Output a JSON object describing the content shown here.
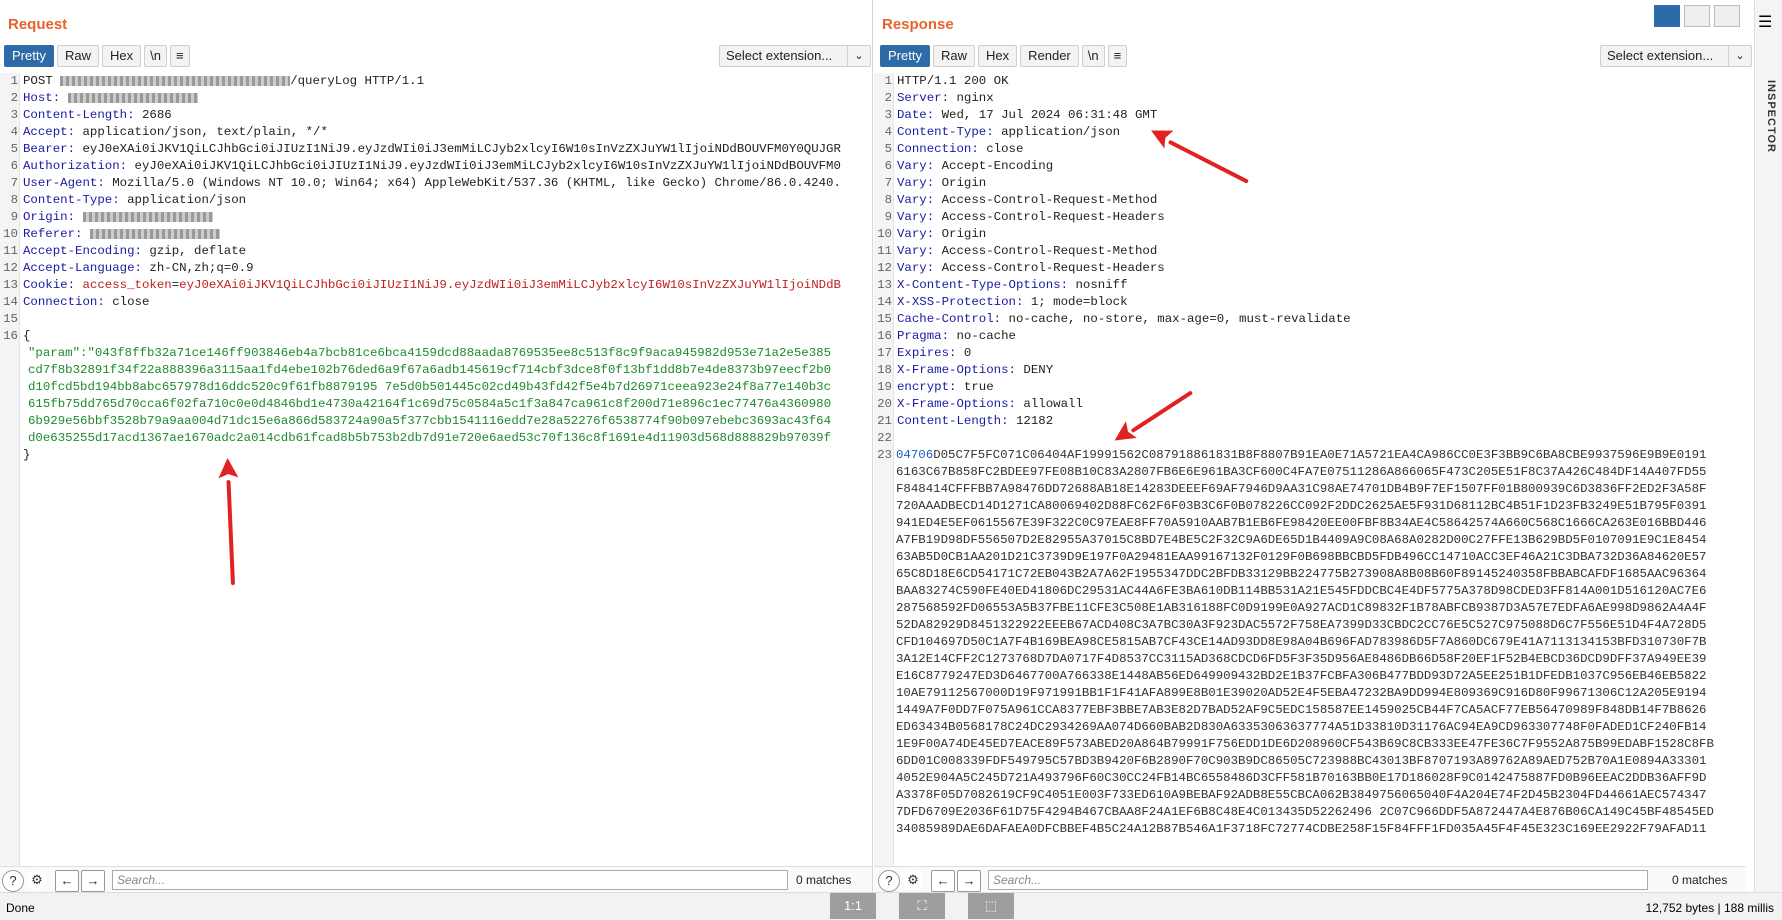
{
  "request": {
    "title": "Request",
    "tabs": [
      "Pretty",
      "Raw",
      "Hex",
      "\\n"
    ],
    "extension": "Select extension...",
    "lines": [
      {
        "n": "1",
        "parts": [
          [
            "plain",
            "POST "
          ],
          [
            "mask",
            ""
          ],
          [
            "plain",
            "/queryLog HTTP/1.1"
          ]
        ]
      },
      {
        "n": "2",
        "parts": [
          [
            "key",
            "Host: "
          ],
          [
            "mask",
            ""
          ]
        ]
      },
      {
        "n": "3",
        "parts": [
          [
            "key",
            "Content-Length: "
          ],
          [
            "plain",
            "2686"
          ]
        ]
      },
      {
        "n": "4",
        "parts": [
          [
            "key",
            "Accept: "
          ],
          [
            "plain",
            "application/json, text/plain, */*"
          ]
        ]
      },
      {
        "n": "5",
        "parts": [
          [
            "key",
            "Bearer: "
          ],
          [
            "plain",
            "eyJ0eXAi0iJKV1QiLCJhbGci0iJIUzI1NiJ9.eyJzdWIi0iJ3emMiLCJyb2xlcyI6W10sInVzZXJuYW1lIjoiNDdBOUVFM0Y0QUJGR"
          ]
        ]
      },
      {
        "n": "6",
        "parts": [
          [
            "key",
            "Authorization: "
          ],
          [
            "plain",
            "eyJ0eXAi0iJKV1QiLCJhbGci0iJIUzI1NiJ9.eyJzdWIi0iJ3emMiLCJyb2xlcyI6W10sInVzZXJuYW1lIjoiNDdBOUVFM0"
          ]
        ]
      },
      {
        "n": "7",
        "parts": [
          [
            "key",
            "User-Agent: "
          ],
          [
            "plain",
            "Mozilla/5.0 (Windows NT 10.0; Win64; x64) AppleWebKit/537.36 (KHTML, like Gecko) Chrome/86.0.4240."
          ]
        ]
      },
      {
        "n": "8",
        "parts": [
          [
            "key",
            "Content-Type: "
          ],
          [
            "plain",
            "application/json"
          ]
        ]
      },
      {
        "n": "9",
        "parts": [
          [
            "key",
            "Origin: "
          ],
          [
            "mask",
            ""
          ]
        ]
      },
      {
        "n": "10",
        "parts": [
          [
            "key",
            "Referer: "
          ],
          [
            "mask",
            ""
          ]
        ]
      },
      {
        "n": "11",
        "parts": [
          [
            "key",
            "Accept-Encoding: "
          ],
          [
            "plain",
            "gzip, deflate"
          ]
        ]
      },
      {
        "n": "12",
        "parts": [
          [
            "key",
            "Accept-Language: "
          ],
          [
            "plain",
            "zh-CN,zh;q=0.9"
          ]
        ]
      },
      {
        "n": "13",
        "parts": [
          [
            "key",
            "Cookie: "
          ],
          [
            "ckey",
            "access_token"
          ],
          [
            "plain",
            "="
          ],
          [
            "ckey",
            "eyJ0eXAi0iJKV1QiLCJhbGci0iJIUzI1NiJ9.eyJzdWIi0iJ3emMiLCJyb2xlcyI6W10sInVzZXJuYW1lIjoiNDdB"
          ]
        ]
      },
      {
        "n": "14",
        "parts": [
          [
            "key",
            "Connection: "
          ],
          [
            "plain",
            "close"
          ]
        ]
      },
      {
        "n": "15",
        "parts": []
      },
      {
        "n": "16",
        "parts": [
          [
            "plain",
            "{"
          ]
        ]
      }
    ],
    "json_lines": [
      "\"param\":\"043f8ffb32a71ce146ff903846eb4a7bcb81ce6bca4159dcd88aada8769535ee8c513f8c9f9aca945982d953e71a2e5e385",
      "cd7f8b32891f34f22a888396a3115aa1fd4ebe102b76ded6a9f67a6adb145619cf714cbf3dce8f0f13bf1dd8b7e4de8373b97eecf2b0",
      "d10fcd5bd194bb8abc657978d16ddc520c9f61fb8879195 7e5d0b501445c02cd49b43fd42f5e4b7d26971ceea923e24f8a77e140b3c",
      "615fb75dd765d70cca6f02fa710c0e0d4846bd1e4730a42164f1c69d75c0584a5c1f3a847ca961c8f200d71e896c1ec77476a4360980",
      "6b929e56bbf3528b79a9aa004d71dc15e6a866d583724a90a5f377cbb1541116edd7e28a52276f6538774f90b097ebebc3693ac43f64",
      "d0e635255d17acd1367ae1670adc2a014cdb61fcad8b5b753b2db7d91e720e6aed53c70f136c8f1691e4d11903d568d888829b97039f"
    ],
    "close_brace": "}",
    "search_placeholder": "Search...",
    "matches": "0 matches"
  },
  "response": {
    "title": "Response",
    "tabs": [
      "Pretty",
      "Raw",
      "Hex",
      "Render",
      "\\n"
    ],
    "extension": "Select extension...",
    "lines": [
      {
        "n": "1",
        "parts": [
          [
            "plain",
            "HTTP/1.1 200 OK"
          ]
        ]
      },
      {
        "n": "2",
        "parts": [
          [
            "key",
            "Server: "
          ],
          [
            "plain",
            "nginx"
          ]
        ]
      },
      {
        "n": "3",
        "parts": [
          [
            "key",
            "Date: "
          ],
          [
            "plain",
            "Wed, 17 Jul 2024 06:31:48 GMT"
          ]
        ]
      },
      {
        "n": "4",
        "parts": [
          [
            "key",
            "Content-Type: "
          ],
          [
            "plain",
            "application/json"
          ]
        ]
      },
      {
        "n": "5",
        "parts": [
          [
            "key",
            "Connection: "
          ],
          [
            "plain",
            "close"
          ]
        ]
      },
      {
        "n": "6",
        "parts": [
          [
            "key",
            "Vary: "
          ],
          [
            "plain",
            "Accept-Encoding"
          ]
        ]
      },
      {
        "n": "7",
        "parts": [
          [
            "key",
            "Vary: "
          ],
          [
            "plain",
            "Origin"
          ]
        ]
      },
      {
        "n": "8",
        "parts": [
          [
            "key",
            "Vary: "
          ],
          [
            "plain",
            "Access-Control-Request-Method"
          ]
        ]
      },
      {
        "n": "9",
        "parts": [
          [
            "key",
            "Vary: "
          ],
          [
            "plain",
            "Access-Control-Request-Headers"
          ]
        ]
      },
      {
        "n": "10",
        "parts": [
          [
            "key",
            "Vary: "
          ],
          [
            "plain",
            "Origin"
          ]
        ]
      },
      {
        "n": "11",
        "parts": [
          [
            "key",
            "Vary: "
          ],
          [
            "plain",
            "Access-Control-Request-Method"
          ]
        ]
      },
      {
        "n": "12",
        "parts": [
          [
            "key",
            "Vary: "
          ],
          [
            "plain",
            "Access-Control-Request-Headers"
          ]
        ]
      },
      {
        "n": "13",
        "parts": [
          [
            "key",
            "X-Content-Type-Options: "
          ],
          [
            "plain",
            "nosniff"
          ]
        ]
      },
      {
        "n": "14",
        "parts": [
          [
            "key",
            "X-XSS-Protection: "
          ],
          [
            "plain",
            "1; mode=block"
          ]
        ]
      },
      {
        "n": "15",
        "parts": [
          [
            "key",
            "Cache-Control: "
          ],
          [
            "plain",
            "no-cache, no-store, max-age=0, must-revalidate"
          ]
        ]
      },
      {
        "n": "16",
        "parts": [
          [
            "key",
            "Pragma: "
          ],
          [
            "plain",
            "no-cache"
          ]
        ]
      },
      {
        "n": "17",
        "parts": [
          [
            "key",
            "Expires: "
          ],
          [
            "plain",
            "0"
          ]
        ]
      },
      {
        "n": "18",
        "parts": [
          [
            "key",
            "X-Frame-Options: "
          ],
          [
            "plain",
            "DENY"
          ]
        ]
      },
      {
        "n": "19",
        "parts": [
          [
            "key",
            "encrypt: "
          ],
          [
            "plain",
            "true"
          ]
        ]
      },
      {
        "n": "20",
        "parts": [
          [
            "key",
            "X-Frame-Options: "
          ],
          [
            "plain",
            "allowall"
          ]
        ]
      },
      {
        "n": "21",
        "parts": [
          [
            "key",
            "Content-Length: "
          ],
          [
            "plain",
            "12182"
          ]
        ]
      },
      {
        "n": "22",
        "parts": []
      },
      {
        "n": "23",
        "parts": []
      }
    ],
    "hex_prefix": "04706",
    "hex_lines": [
      "D05C7F5FC071C06404AF19991562C087918861831B8F8807B91EA0E71A5721EA4CA986CC0E3F3BB9C6BA8CBE9937596E9B9E0191",
      "6163C67B858FC2BDEE97FE08B10C83A2807FB6E6E961BA3CF600C4FA7E07511286A866065F473C205E51F8C37A426C484DF14A407FD55",
      "F848414CFFFBB7A98476DD72688AB18E14283DEEEF69AF7946D9AA31C98AE74701DB4B9F7EF1507FF01B800939C6D3836FF2ED2F3A58F",
      "720AAADBECD14D1271CA80069402D88FC62F6F03B3C6F0B078226CC092F2DDC2625AE5F931D68112BC4B51F1D23FB3249E51B795F0391",
      "941ED4E5EF0615567E39F322C0C97EAE8FF70A5910AAB7B1EB6FE98420EE00FBF8B34AE4C58642574A660C568C1666CA263E016BBD446",
      "A7FB19D98DF556507D2E82955A37015C8BD7E4BE5C2F32C9A6DE65D1B4409A9C08A68A0282D00C27FFE13B629BD5F0107091E9C1E8454",
      "63AB5D0CB1AA201D21C3739D9E197F0A29481EAA99167132F0129F0B698BBCBD5FDB496CC14710ACC3EF46A21C3DBA732D36A84620E57",
      "65C8D18E6CD54171C72EB043B2A7A62F1955347DDC2BFDB33129BB224775B273908A8B08B60F89145240358FBBABCAFDF1685AAC96364",
      "BAA83274C590FE40ED41806DC29531AC44A6FE3BA610DB114BB531A21E545FDDCBC4E4DF5775A378D98CDED3FF814A001D516120AC7E6",
      "287568592FD06553A5B37FBE11CFE3C508E1AB316188FC0D9199E0A927ACD1C89832F1B78ABFCB9387D3A57E7EDFA6AE998D9862A4A4F",
      "52DA82929D8451322922EEEB67ACD408C3A7BC30A3F923DAC5572F758EA7399D33CBDC2CC76E5C527C975088D6C7F556E51D4F4A728D5",
      "CFD104697D50C1A7F4B169BEA98CE5815AB7CF43CE14AD93DD8E98A04B696FAD783986D5F7A860DC679E41A7113134153BFD310730F7B",
      "3A12E14CFF2C1273768D7DA0717F4D8537CC3115AD368CDCD6FD5F3F35D956AE8486DB66D58F20EF1F52B4EBCD36DCD9DFF37A949EE39",
      "E16C8779247ED3D6467700A766338E1448AB56ED649909432BD2E1B37FCBFA306B477BDD93D72A5EE251B1DFEDB1037C956EB46EB5822",
      "10AE79112567000D19F971991BB1F1F41AFA899E8B01E39020AD52E4F5EBA47232BA9DD994E809369C916D80F99671306C12A205E9194",
      "1449A7F0DD7F075A961CCA8377EBF3BBE7AB3E82D7BAD52AF9C5EDC158587EE1459025CB44F7CA5ACF77EB56470989F848DB14F7B8626",
      "ED63434B0568178C24DC2934269AA074D660BAB2D830A63353063637774A51D33810D31176AC94EA9CD963307748F0FADED1CF240FB14",
      "1E9F00A74DE45ED7EACE89F573ABED20A864B79991F756EDD1DE6D208960CF543B69C8CB333EE47FE36C7F9552A875B99EDABF1528C8FB",
      "6DD01C008339FDF549795C57BD3B9420F6B2890F70C903B9DC86505C723988BC43013BF8707193A89762A89AED752B70A1E0894A33301",
      "4052E904A5C245D721A493796F60C30CC24FB14BC6558486D3CFF581B70163BB0E17D186028F9C0142475887FD0B96EEAC2DDB36AFF9D",
      "A3378F05D7082619CF9C4051E003F733ED610A9BEBAF92ADB8E55CBCA062B3849756065040F4A204E74F2D45B2304FD44661AEC574347",
      "7DFD6709E2036F61D75F4294B467CBAA8F24A1EF6B8C48E4C013435D52262496 2C07C966DDF5A872447A4E876B06CA149C45BF48545ED",
      "34085989DAE6DAFAEA0DFCBBEF4B5C24A12B87B546A1F3718FC72774CDBE258F15F84FFF1FD035A45F4F45E323C169EE2922F79AFAD11"
    ],
    "search_placeholder": "Search...",
    "matches": "0 matches"
  },
  "sidebar": {
    "label": "INSPECTOR"
  },
  "status": {
    "left": "Done",
    "right": "12,752 bytes | 188 millis",
    "btn1": "1:1"
  },
  "colors": {
    "accent": "#e8632b",
    "active_tab": "#2c6aa8",
    "annotation_arrow": "#e02222"
  }
}
